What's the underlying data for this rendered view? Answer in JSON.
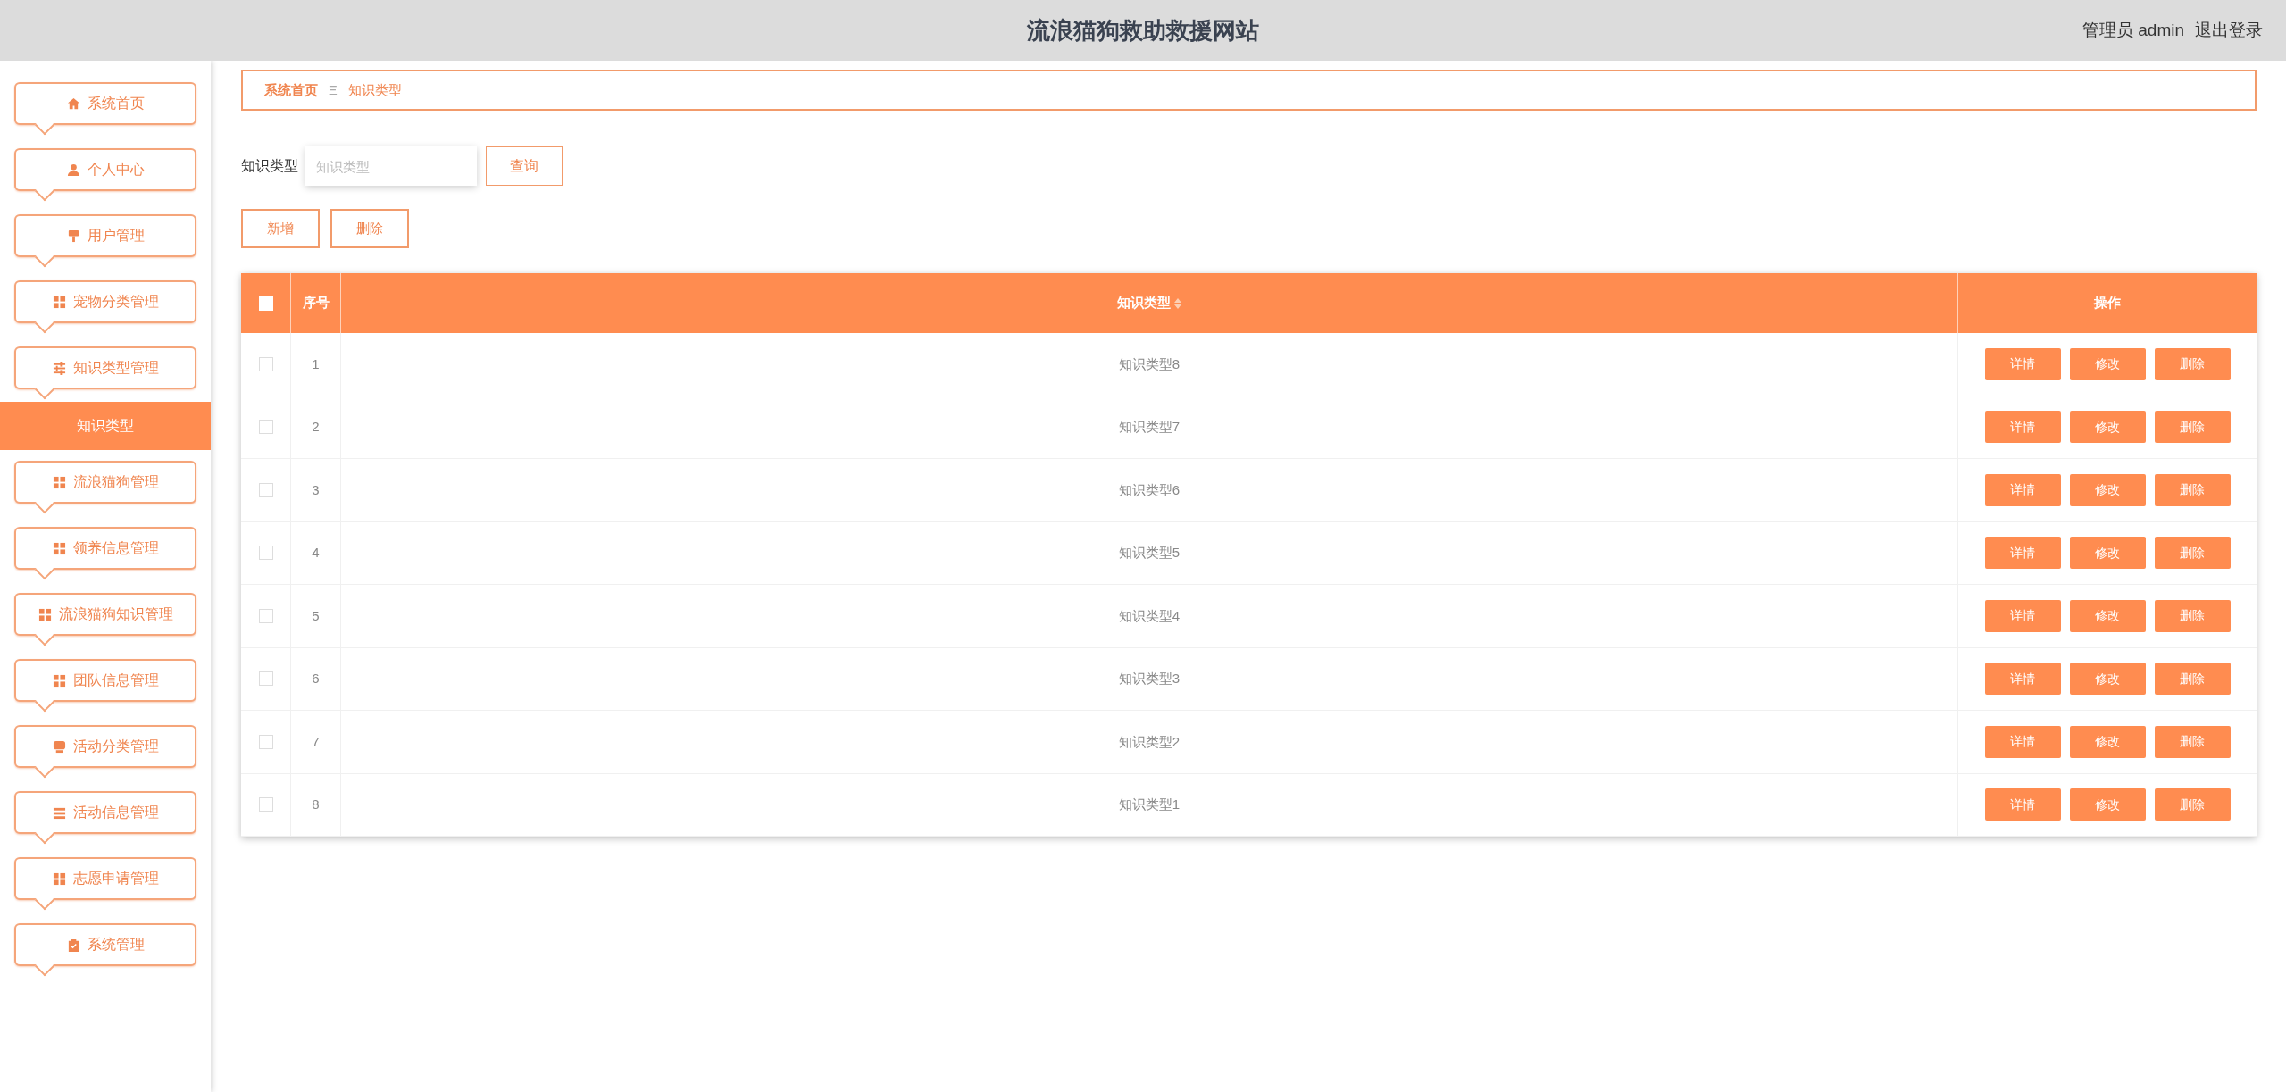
{
  "header": {
    "title": "流浪猫狗救助救援网站",
    "user": "管理员 admin",
    "logout": "退出登录"
  },
  "sidebar": {
    "items": [
      {
        "label": "系统首页",
        "kind": "home"
      },
      {
        "label": "个人中心",
        "kind": "user"
      },
      {
        "label": "用户管理",
        "kind": "sign"
      },
      {
        "label": "宠物分类管理",
        "kind": "grid"
      },
      {
        "label": "知识类型管理",
        "kind": "sliders",
        "children": [
          {
            "label": "知识类型",
            "selected": true
          }
        ]
      },
      {
        "label": "流浪猫狗管理",
        "kind": "grid"
      },
      {
        "label": "领养信息管理",
        "kind": "grid"
      },
      {
        "label": "流浪猫狗知识管理",
        "kind": "grid"
      },
      {
        "label": "团队信息管理",
        "kind": "grid"
      },
      {
        "label": "活动分类管理",
        "kind": "chat"
      },
      {
        "label": "活动信息管理",
        "kind": "list"
      },
      {
        "label": "志愿申请管理",
        "kind": "grid"
      },
      {
        "label": "系统管理",
        "kind": "clipboard"
      }
    ]
  },
  "breadcrumb": {
    "items": [
      "系统首页",
      "知识类型"
    ],
    "separator": "Ξ"
  },
  "search": {
    "label": "知识类型",
    "placeholder": "知识类型",
    "button": "查询"
  },
  "actions": [
    "新增",
    "删除"
  ],
  "table": {
    "header_checked": false,
    "columns": [
      "序号",
      "知识类型",
      "操作"
    ],
    "rows": [
      {
        "checked": false,
        "index": "1",
        "name": "知识类型8",
        "actions": [
          "详情",
          "修改",
          "删除"
        ]
      },
      {
        "checked": false,
        "index": "2",
        "name": "知识类型7",
        "actions": [
          "详情",
          "修改",
          "删除"
        ]
      },
      {
        "checked": false,
        "index": "3",
        "name": "知识类型6",
        "actions": [
          "详情",
          "修改",
          "删除"
        ]
      },
      {
        "checked": false,
        "index": "4",
        "name": "知识类型5",
        "actions": [
          "详情",
          "修改",
          "删除"
        ]
      },
      {
        "checked": false,
        "index": "5",
        "name": "知识类型4",
        "actions": [
          "详情",
          "修改",
          "删除"
        ]
      },
      {
        "checked": false,
        "index": "6",
        "name": "知识类型3",
        "actions": [
          "详情",
          "修改",
          "删除"
        ]
      },
      {
        "checked": false,
        "index": "7",
        "name": "知识类型2",
        "actions": [
          "详情",
          "修改",
          "删除"
        ]
      },
      {
        "checked": false,
        "index": "8",
        "name": "知识类型1",
        "actions": [
          "详情",
          "修改",
          "删除"
        ]
      }
    ]
  }
}
